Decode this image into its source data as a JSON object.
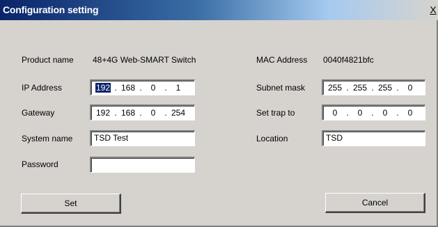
{
  "window": {
    "title": "Configuration setting",
    "close_glyph": "X"
  },
  "left": {
    "product_name_label": "Product name",
    "product_name_value": "48+4G Web-SMART Switch",
    "ip_label": "IP Address",
    "ip": [
      "192",
      "168",
      "0",
      "1"
    ],
    "gateway_label": "Gateway",
    "gateway": [
      "192",
      "168",
      "0",
      "254"
    ],
    "system_name_label": "System name",
    "system_name_value": "TSD Test",
    "password_label": "Password",
    "password_value": ""
  },
  "right": {
    "mac_label": "MAC Address",
    "mac_value": "0040f4821bfc",
    "subnet_label": "Subnet mask",
    "subnet": [
      "255",
      "255",
      "255",
      "0"
    ],
    "trap_label": "Set trap to",
    "trap": [
      "0",
      "0",
      "0",
      "0"
    ],
    "location_label": "Location",
    "location_value": "TSD"
  },
  "buttons": {
    "set": "Set",
    "cancel": "Cancel"
  }
}
